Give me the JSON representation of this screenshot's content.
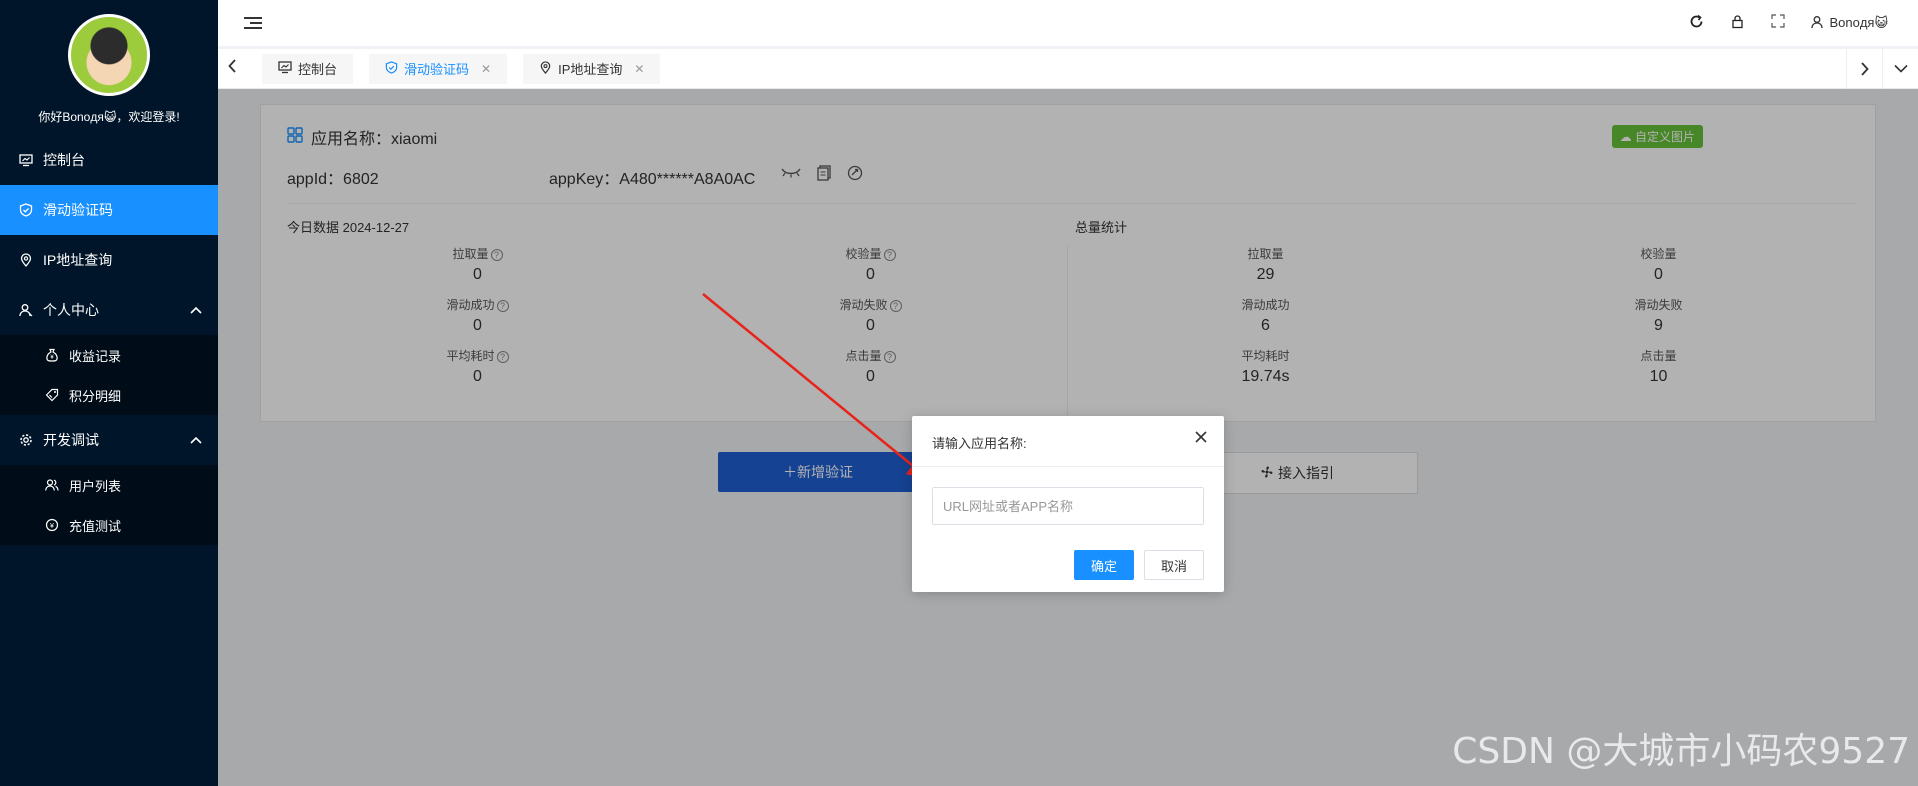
{
  "sidebar": {
    "greeting": "你好Bonoдя😺，欢迎登录!",
    "items": [
      {
        "label": "控制台"
      },
      {
        "label": "滑动验证码"
      },
      {
        "label": "IP地址查询"
      },
      {
        "label": "个人中心"
      },
      {
        "label": "收益记录"
      },
      {
        "label": "积分明细"
      },
      {
        "label": "开发调试"
      },
      {
        "label": "用户列表"
      },
      {
        "label": "充值测试"
      }
    ]
  },
  "topbar": {
    "username": "Bonoдя😺"
  },
  "tabs": [
    {
      "label": "控制台"
    },
    {
      "label": "滑动验证码"
    },
    {
      "label": "IP地址查询"
    }
  ],
  "app": {
    "name_label": "应用名称：xiaomi",
    "custom_image_label": "自定义图片",
    "appid": "appId：6802",
    "appkey": "appKey：A480******A8A0AC"
  },
  "today": {
    "title": "今日数据 2024-12-27",
    "stats": [
      {
        "label": "拉取量",
        "value": "0"
      },
      {
        "label": "校验量",
        "value": "0"
      },
      {
        "label": "滑动成功",
        "value": "0"
      },
      {
        "label": "滑动失败",
        "value": "0"
      },
      {
        "label": "平均耗时",
        "value": "0"
      },
      {
        "label": "点击量",
        "value": "0"
      }
    ]
  },
  "total": {
    "title": "总量统计",
    "stats": [
      {
        "label": "拉取量",
        "value": "29"
      },
      {
        "label": "校验量",
        "value": "0"
      },
      {
        "label": "滑动成功",
        "value": "6"
      },
      {
        "label": "滑动失败",
        "value": "9"
      },
      {
        "label": "平均耗时",
        "value": "19.74s"
      },
      {
        "label": "点击量",
        "value": "10"
      }
    ]
  },
  "actions": {
    "add_label": "＋新增验证",
    "guide_label": "接入指引"
  },
  "dialog": {
    "title": "请输入应用名称:",
    "input_value": "",
    "placeholder": "URL网址或者APP名称",
    "ok_label": "确定",
    "cancel_label": "取消"
  },
  "watermark": "CSDN @大城市小码农9527",
  "colors": {
    "sidebar_bg": "#001529",
    "active_menu": "#1890ff",
    "primary_button": "#1890ff",
    "add_button": "#1f5fd1",
    "custom_image_button": "#67c23a",
    "arrow": "#e8231a"
  }
}
